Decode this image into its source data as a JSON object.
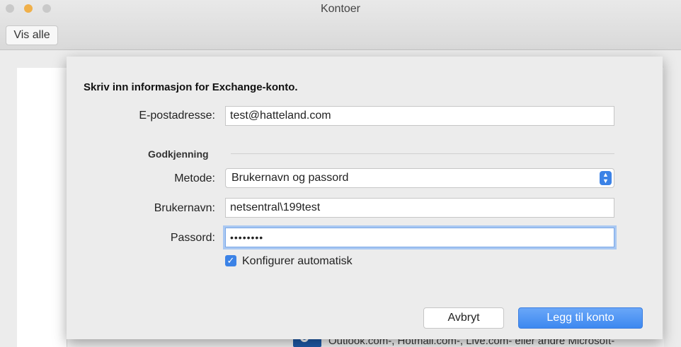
{
  "window": {
    "title": "Kontoer",
    "show_all": "Vis alle"
  },
  "dialog": {
    "heading": "Skriv inn informasjon for Exchange-konto.",
    "email": {
      "label": "E-postadresse:",
      "value": "test@hatteland.com"
    },
    "auth_section": "Godkjenning",
    "method": {
      "label": "Metode:",
      "value": "Brukernavn og passord"
    },
    "username": {
      "label": "Brukernavn:",
      "value": "netsentral\\199test"
    },
    "password": {
      "label": "Passord:",
      "value": "••••••••"
    },
    "auto_config": {
      "label": "Konfigurer automatisk",
      "checked": true
    },
    "buttons": {
      "cancel": "Avbryt",
      "add": "Legg til konto"
    }
  },
  "background": {
    "text": "Outlook.com-, Hotmail.com-, Live.com- eller andre Microsoft-"
  },
  "colors": {
    "accent": "#3b82e6"
  }
}
